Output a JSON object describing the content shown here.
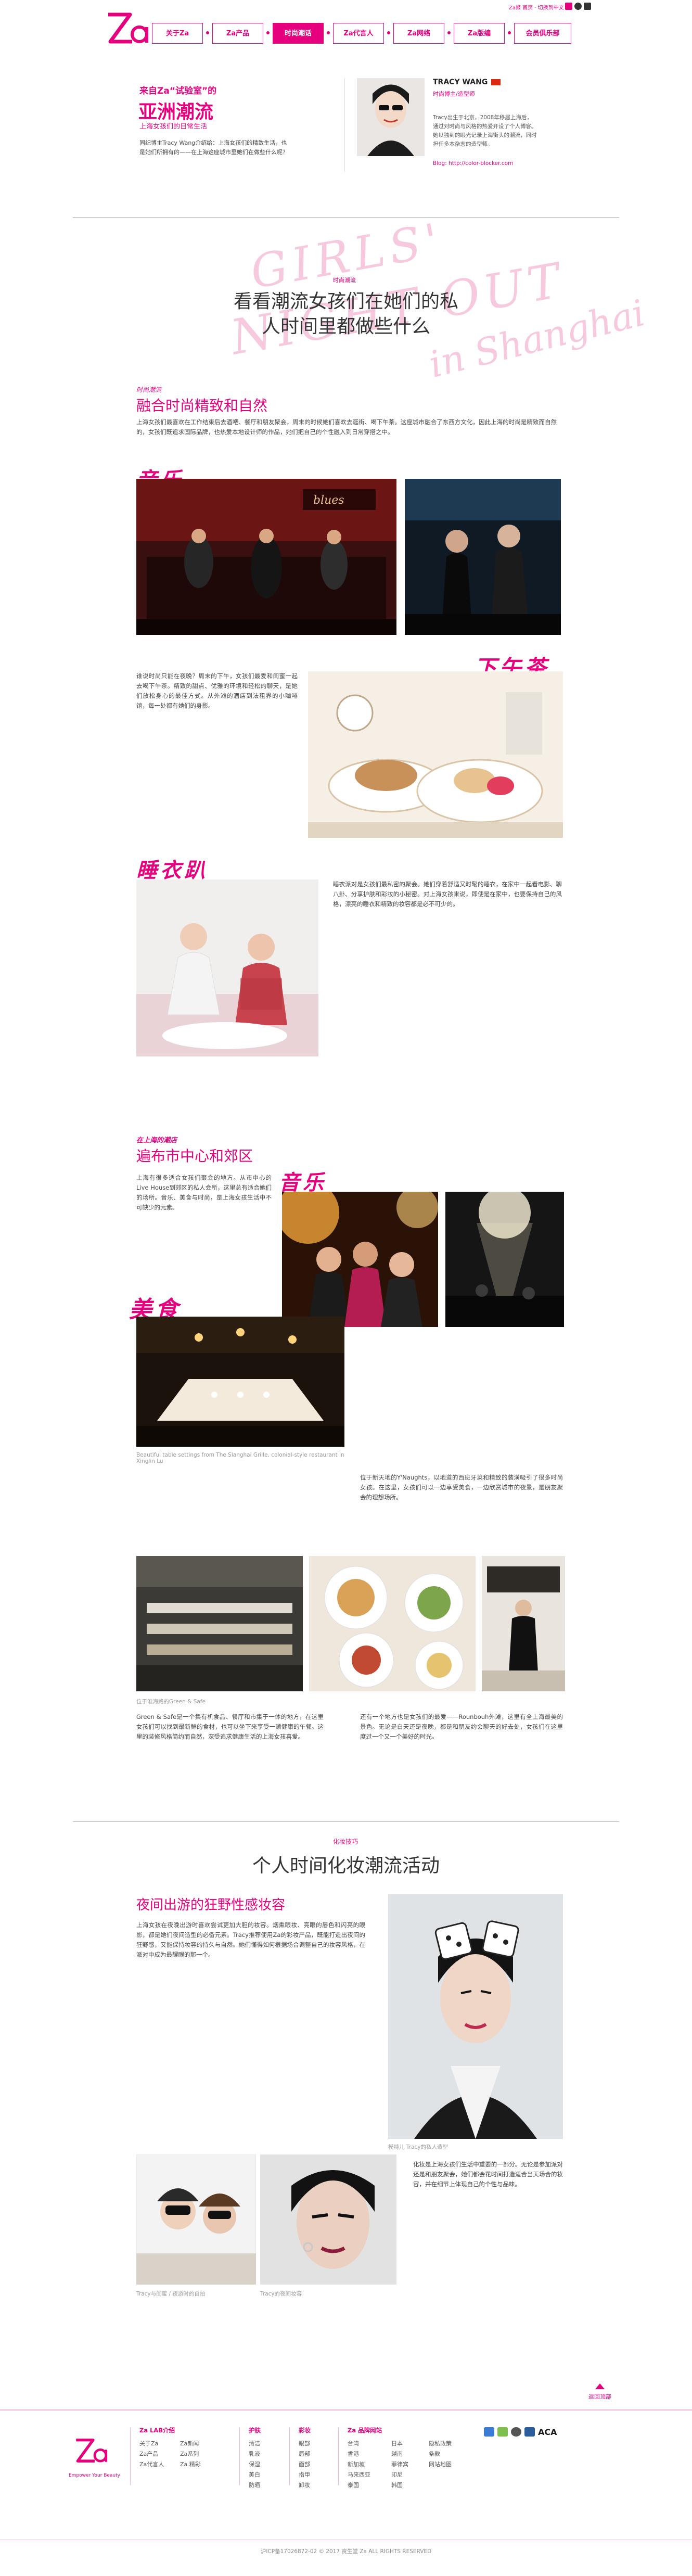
{
  "header": {
    "logo_text": "Za",
    "nav": [
      "关于Za",
      "Za产品",
      "时尚潮话",
      "Za代言人",
      "Za网络",
      "Za版编",
      "会员俱乐部"
    ],
    "nav_active_index": 2,
    "top_bar_text": "Za姬 首页 · 切换到中文",
    "top_bar_icons": [
      "facebook-icon",
      "weibo-icon",
      "rss-icon"
    ]
  },
  "intro": {
    "kicker": "来自Za",
    "kicker_quote": "“试验室”的",
    "title": "亚洲潮流",
    "subtitle": "上海女孩们的日常生活",
    "desc": "同纪博主Tracy Wang介绍给：上海女孩们的精致生活，也是她们所拥有的——在上海这座城市里她们在做些什么呢？"
  },
  "profile": {
    "name": "TRACY WANG",
    "role": "时尚博主/造型师",
    "bio": "Tracy出生于北京，2008年移居上海后，通过对时尚与风格的热爱开设了个人博客。她以独到的眼光记录上海街头的潮流，同时担任多本杂志的造型师。",
    "blog_label": "Blog:",
    "blog_url": "http://color-blocker.com"
  },
  "section1": {
    "watermark_1": "GIRLS'",
    "watermark_2": "NIGHT OUT",
    "watermark_3": "in Shanghai",
    "kicker": "时尚潮流",
    "headline_1": "看看潮流女孩们在她们的私",
    "headline_2": "人时间里都做些什么"
  },
  "mix": {
    "kicker": "时尚潮流",
    "title": "融合时尚精致和自然",
    "para": "上海女孩们最喜欢在工作结束后去酒吧、餐厅和朋友聚会，周末的时候她们喜欢去逛街、喝下午茶。这座城市融合了东西方文化，因此上海的时尚是精致而自然的，女孩们既追求国际品牌，也热爱本地设计师的作品，她们把自己的个性融入到日常穿搭之中。",
    "music_script": "音乐",
    "afternoon_script": "下午茶",
    "afternoon_para": "谁说时尚只能在夜晚？周末的下午，女孩们最爱和闺蜜一起去喝下午茶。精致的甜点、优雅的环境和轻松的聊天，是她们放松身心的最佳方式。从外滩的酒店到法租界的小咖啡馆，每一处都有她们的身影。",
    "pajama_script": "睡衣趴",
    "pajama_para": "睡衣派对是女孩们最私密的聚会。她们穿着舒适又时髦的睡衣，在家中一起看电影、聊八卦、分享护肤和彩妆的小秘密。对上海女孩来说，即使是在家中，也要保持自己的风格，漂亮的睡衣和精致的妆容都是必不可少的。"
  },
  "places": {
    "kicker": "在上海的潮店",
    "title": "遍布市中心和郊区",
    "para": "上海有很多适合女孩们聚会的地方。从市中心的Live House到郊区的私人会所，这里总有适合她们的场所。音乐、美食与时尚，是上海女孩生活中不可缺少的元素。",
    "music_script": "音乐",
    "food_script": "美食",
    "food_caption": "Beautiful table settings from The Slanghai Grille, colonial-style restaurant in Xinglin Lu",
    "food_para": "位于新天地的Y'Naughts，以地道的西班牙菜和精致的装潢吸引了很多时尚女孩。在这里，女孩们可以一边享受美食，一边欣赏城市的夜景，是朋友聚会的理想场所。",
    "green_caption": "位于淮海路的Green & Safe",
    "green_para_left": "Green & Safe是一个集有机食品、餐厅和市集于一体的地方，在这里女孩们可以找到最新鲜的食材，也可以坐下来享受一顿健康的午餐。这里的装修风格简约而自然，深受追求健康生活的上海女孩喜爱。",
    "green_para_right": "还有一个地方也是女孩们的最爱——Rounbouh外滩，这里有全上海最美的景色。无论是白天还是夜晚，都是和朋友约会聊天的好去处，女孩们在这里度过一个又一个美好的时光。"
  },
  "makeup": {
    "kicker": "化妆技巧",
    "headline": "个人时间化妆潮流活动",
    "title": "夜间出游的狂野性感妆容",
    "para": "上海女孩在夜晚出游时喜欢尝试更加大胆的妆容。烟熏眼妆、亮眼的唇色和闪亮的眼影，都是她们夜间造型的必备元素。Tracy推荐使用Za的彩妆产品，既能打造出夜间的狂野感，又能保持妆容的持久与自然。她们懂得如何根据场合调整自己的妆容风格，在派对中成为最耀眼的那一个。",
    "portrait_caption": "模特儿 Tracy的私人造型",
    "para2": "化妆是上海女孩们生活中重要的一部分。无论是参加派对还是和朋友聚会，她们都会花时间打造适合当天场合的妆容，并在细节上体现自己的个性与品味。",
    "caption_left": "Tracy与闺蜜 / 夜游时的自拍",
    "caption_right": "Tracy的夜间妆容"
  },
  "back_top": "返回顶部",
  "footer": {
    "tagline": "Empower Your Beauty",
    "col1_head": "Za LAB介绍",
    "col1_items": [
      "关于Za",
      "Za产品",
      "Za代言人"
    ],
    "col1b_items": [
      "Za新闻",
      "Za系列",
      "Za 精彩"
    ],
    "col2_head": "护肤",
    "col2_items": [
      "清洁",
      "乳液",
      "保湿",
      "美白",
      "防晒"
    ],
    "col3_head": "彩妆",
    "col3_items": [
      "眼部",
      "唇部",
      "面部",
      "指甲",
      "卸妆"
    ],
    "col4_head": "Za 品牌网站",
    "col4_items": [
      "台湾",
      "香港",
      "新加坡",
      "马来西亚",
      "泰国"
    ],
    "col5_items": [
      "日本",
      "越南",
      "菲律宾",
      "印尼",
      "韩国"
    ],
    "col6_items": [
      "隐私政策",
      "条款",
      "网站地图"
    ],
    "badges": [
      "ACA"
    ],
    "copyright": "沪ICP备17026872-02 © 2017 资生堂 Za ALL RIGHTS RESERVED"
  },
  "colors": {
    "accent": "#e6007e",
    "accent_light": "#f2b4d2"
  }
}
